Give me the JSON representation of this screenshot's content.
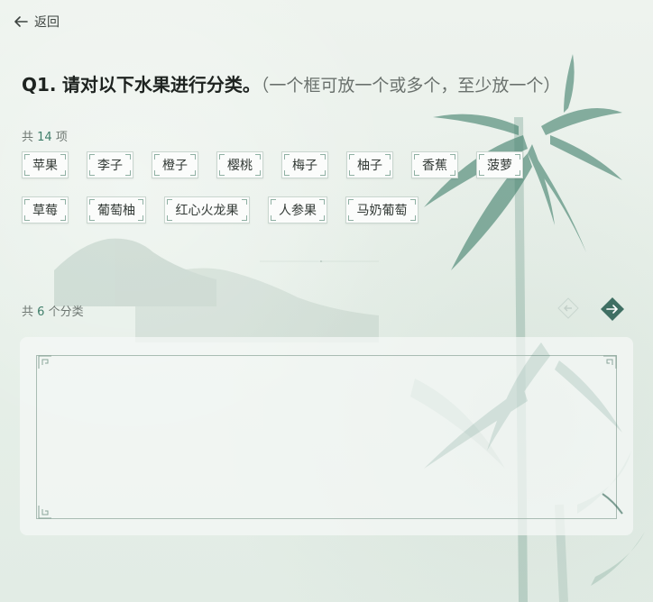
{
  "header": {
    "back_label": "返回"
  },
  "question": {
    "number": "Q1.",
    "prompt": "请对以下水果进行分类。",
    "hint": "（一个框可放一个或多个，至少放一个）"
  },
  "items": {
    "count_prefix": "共",
    "count": "14",
    "count_suffix": "项",
    "list": [
      "苹果",
      "李子",
      "橙子",
      "樱桃",
      "梅子",
      "柚子",
      "香蕉",
      "菠萝",
      "草莓",
      "葡萄柚",
      "红心火龙果",
      "人参果",
      "马奶葡萄"
    ]
  },
  "categories": {
    "count_prefix": "共",
    "count": "6",
    "count_suffix": "个分类"
  },
  "colors": {
    "accent": "#3f7e6a",
    "nav_button": "#3f6f63"
  },
  "icons": {
    "back": "arrow-left-icon",
    "prev": "chevron-left-icon",
    "next": "arrow-right-icon"
  }
}
